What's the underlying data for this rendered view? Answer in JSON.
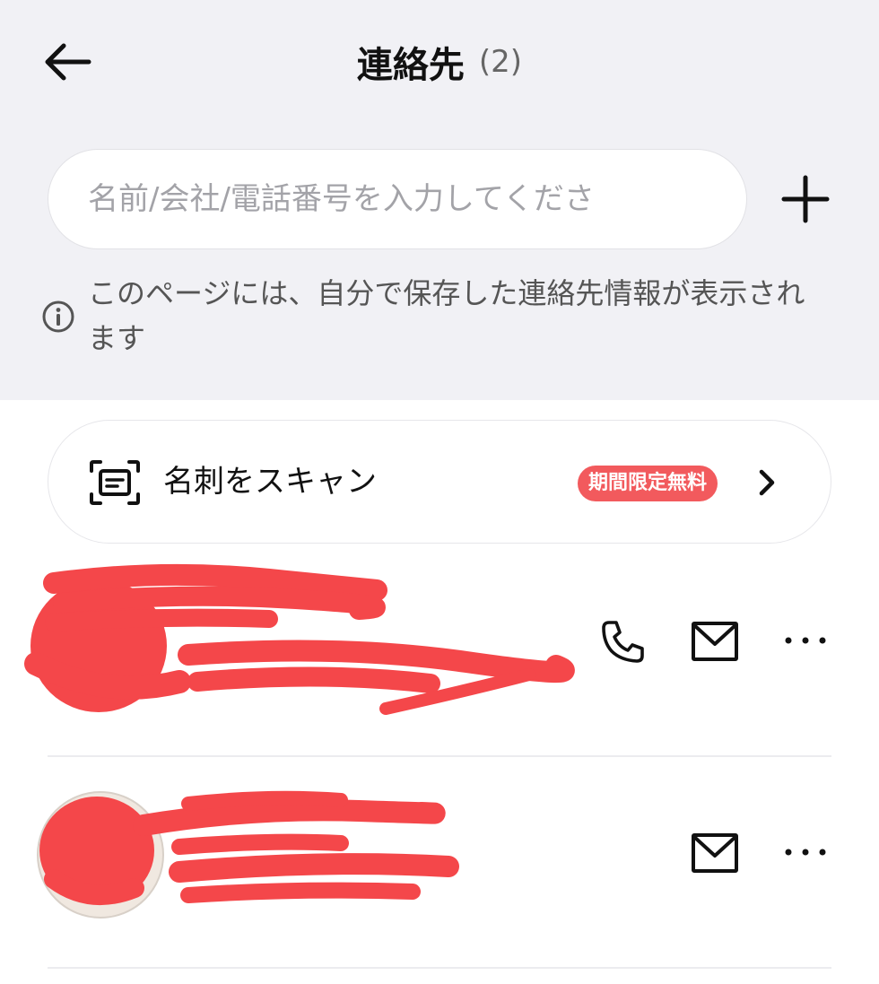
{
  "header": {
    "title": "連絡先",
    "count": "(2)",
    "back_icon": "arrow-left-icon"
  },
  "search": {
    "placeholder": "名前/会社/電話番号を入力してくださ",
    "value": "",
    "add_icon": "plus-icon"
  },
  "info": {
    "icon": "info-icon",
    "text": "このページには、自分で保存した連絡先情報が表示されます"
  },
  "scan_card": {
    "icon": "scan-card-icon",
    "label": "名刺をスキャン",
    "badge": "期間限定無料",
    "badge_color": "#f25a5d",
    "chevron_icon": "chevron-right-icon"
  },
  "contacts": [
    {
      "redacted": true,
      "actions": [
        "phone-icon",
        "mail-icon",
        "more-icon"
      ]
    },
    {
      "redacted": true,
      "actions": [
        "mail-icon",
        "more-icon"
      ]
    }
  ],
  "colors": {
    "header_bg": "#f1f1f5",
    "redaction": "#f4474a"
  }
}
